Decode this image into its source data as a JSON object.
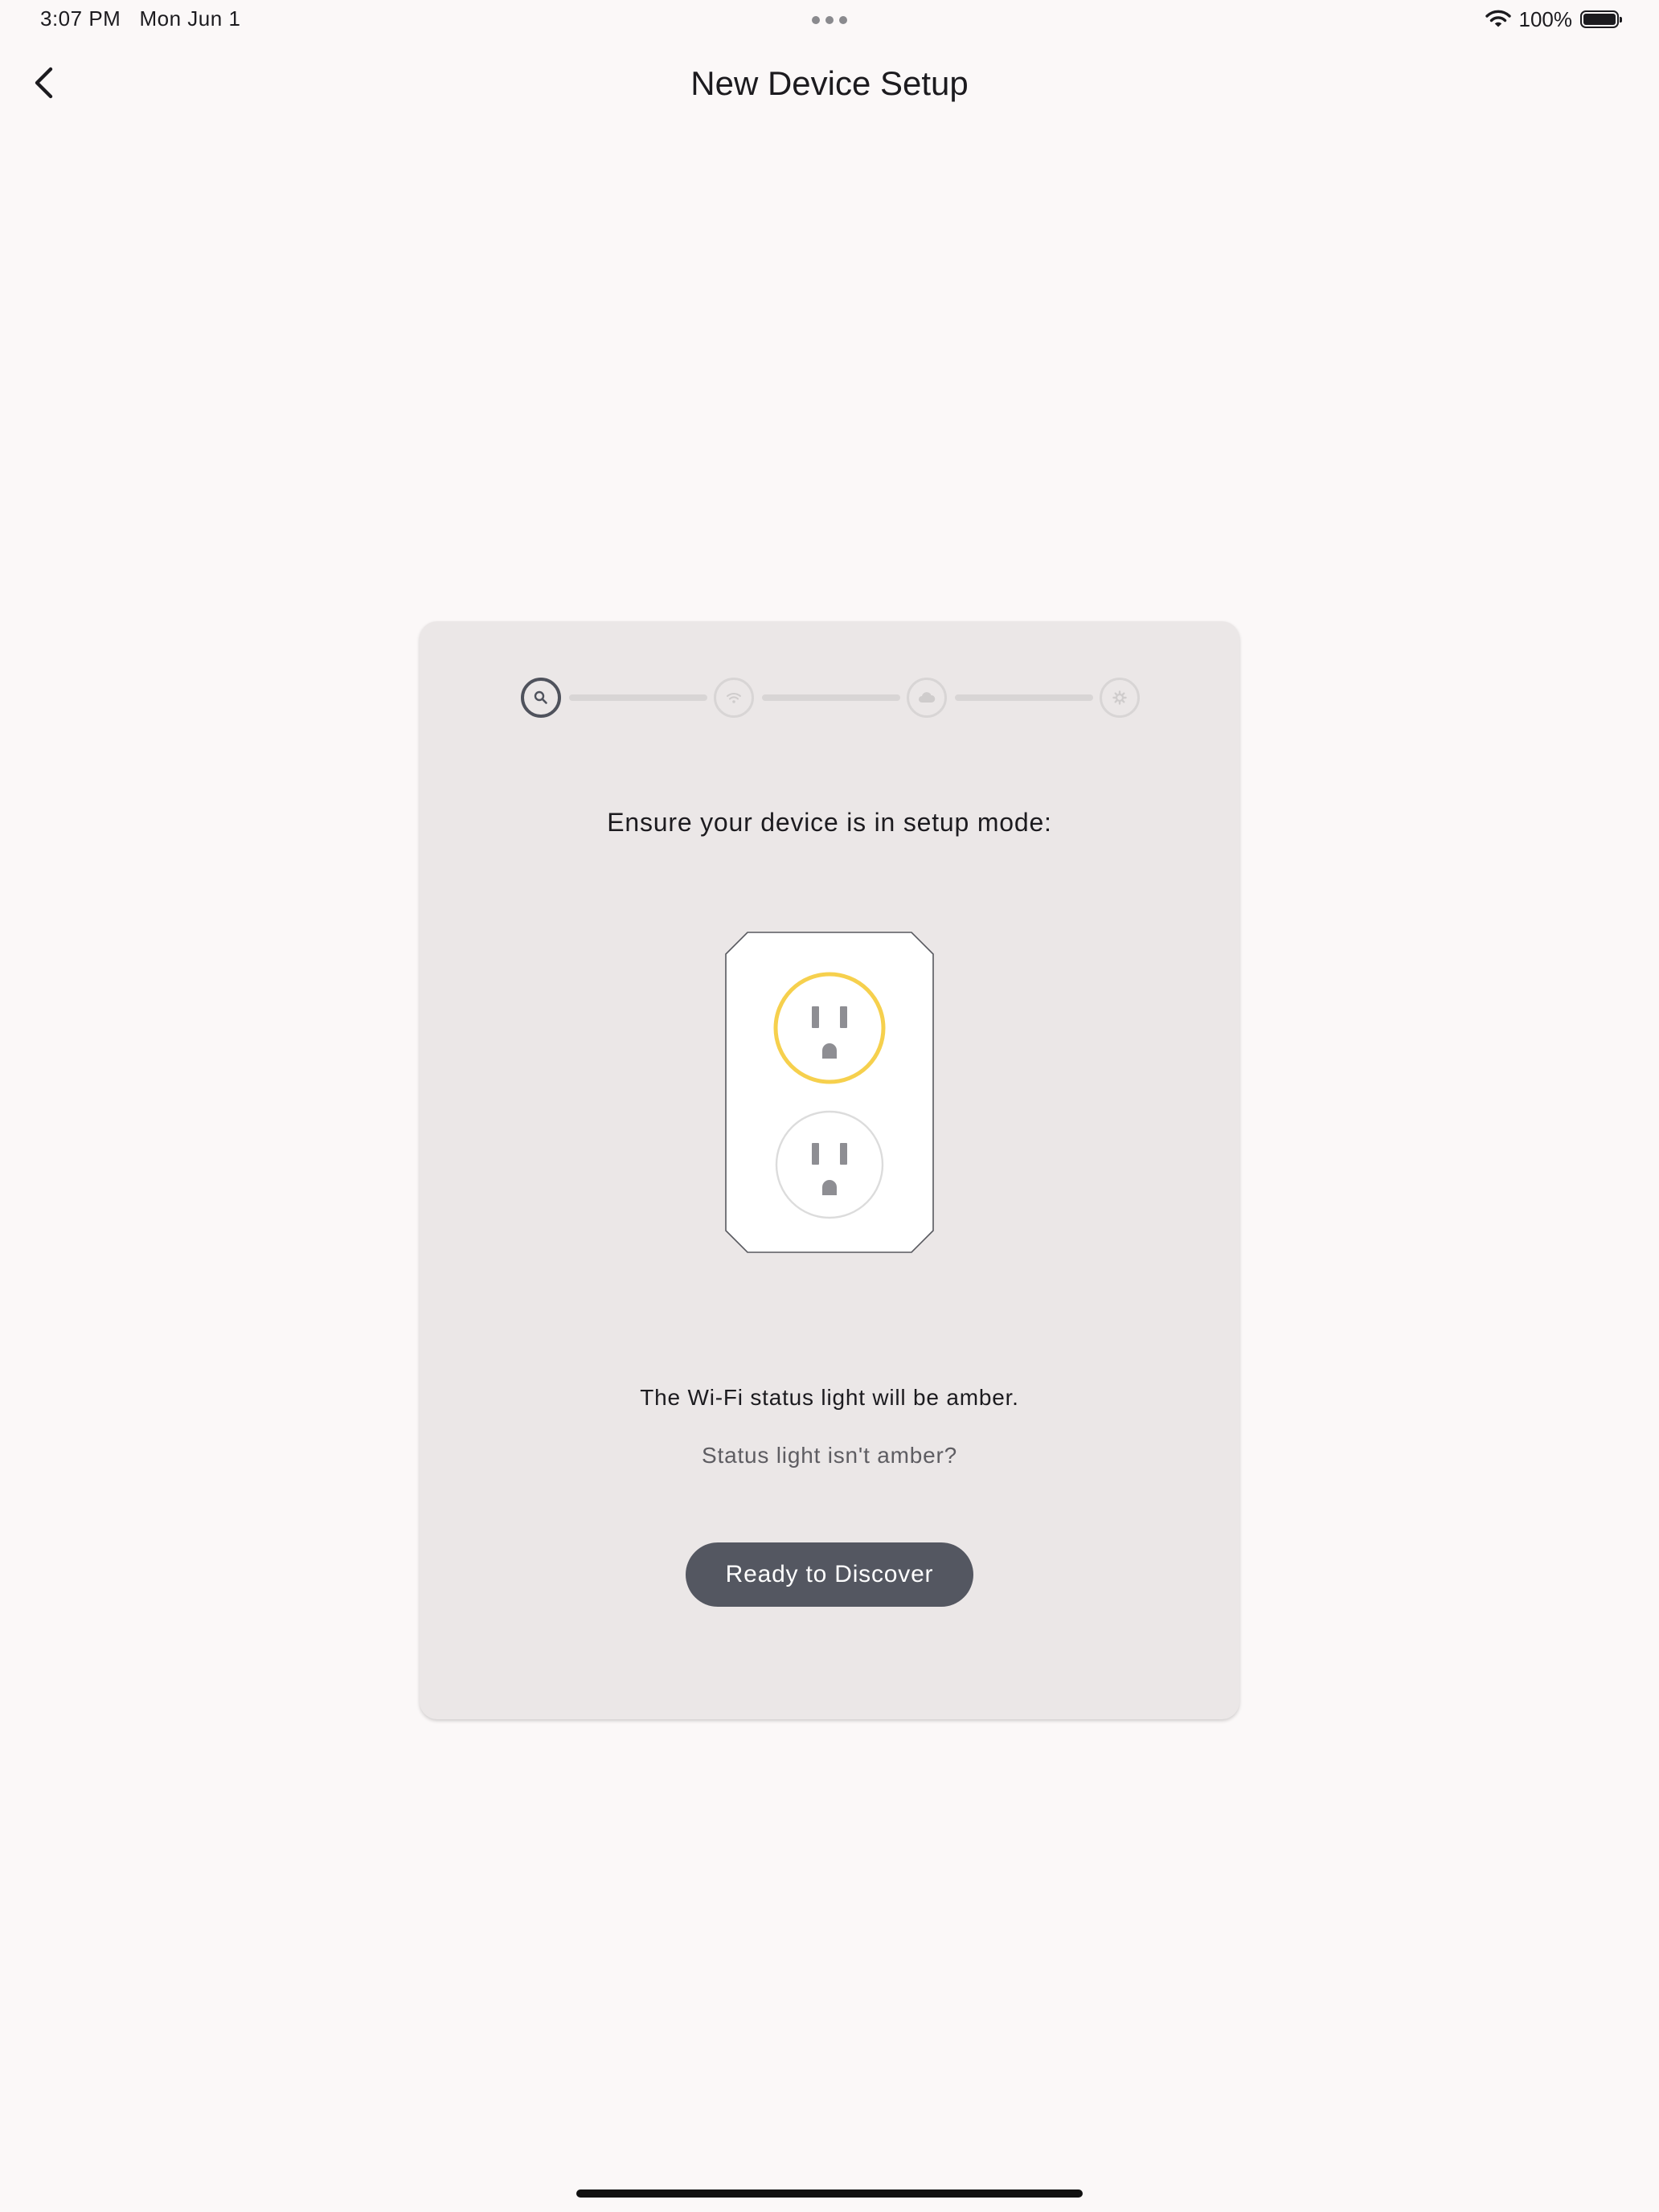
{
  "status_bar": {
    "time": "3:07 PM",
    "date": "Mon Jun 1",
    "battery_percent": "100%",
    "battery_level": 1.0,
    "icons": [
      "wifi-icon",
      "battery-icon",
      "more-dots-icon"
    ]
  },
  "nav": {
    "title": "New Device Setup",
    "back_icon": "chevron-left-icon"
  },
  "stepper": {
    "current_step": 1,
    "total_steps": 4,
    "steps": [
      {
        "icon": "search-icon",
        "state": "active"
      },
      {
        "icon": "wifi-icon",
        "state": "inactive"
      },
      {
        "icon": "cloud-icon",
        "state": "inactive"
      },
      {
        "icon": "gear-icon",
        "state": "inactive"
      }
    ]
  },
  "card": {
    "heading": "Ensure your device is in setup mode:",
    "status_message": "The Wi-Fi status light will be amber.",
    "help_link": "Status light isn't amber?",
    "primary_button": "Ready to Discover"
  },
  "illustration": {
    "name": "smart-plug-illustration",
    "highlight_color": "#f6d04d",
    "outlets": [
      {
        "position": "top",
        "highlighted": true
      },
      {
        "position": "bottom",
        "highlighted": false
      }
    ]
  },
  "colors": {
    "background": "#fbf8f8",
    "card": "#ebe7e7",
    "button": "#545761",
    "amber": "#f6d04d"
  }
}
